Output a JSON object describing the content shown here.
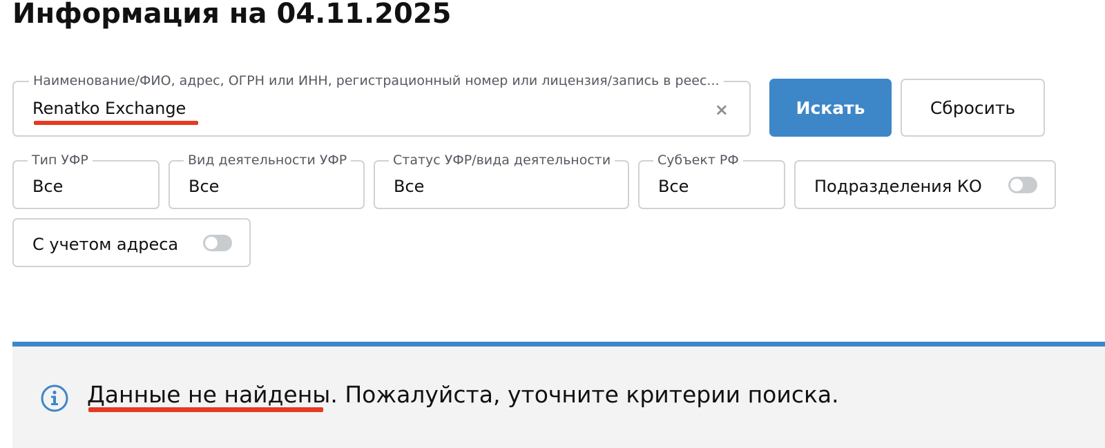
{
  "page_title": "Информация на 04.11.2025",
  "search": {
    "label": "Наименование/ФИО, адрес, ОГРН или ИНН, регистрационный номер или лицензия/запись в реес...",
    "value": "Renatko Exchange",
    "clear_glyph": "×"
  },
  "buttons": {
    "search_label": "Искать",
    "reset_label": "Сбросить"
  },
  "filters": [
    {
      "label": "Тип УФР",
      "value": "Все"
    },
    {
      "label": "Вид деятельности УФР",
      "value": "Все"
    },
    {
      "label": "Статус УФР/вида деятельности",
      "value": "Все"
    },
    {
      "label": "Субъект РФ",
      "value": "Все"
    }
  ],
  "toggles": [
    {
      "label": "Подразделения КО",
      "enabled": false
    },
    {
      "label": "С учетом адреса",
      "enabled": false
    }
  ],
  "result": {
    "highlight": "Данные не найдены.",
    "message": " Пожалуйста, уточните критерии поиска."
  },
  "colors": {
    "accent": "#3d86c8",
    "annotation_underline": "#e43b23",
    "panel_background": "#f3f3f3",
    "border": "#cfd2d6"
  },
  "icons": {
    "info": "info-icon",
    "clear": "close-icon"
  }
}
